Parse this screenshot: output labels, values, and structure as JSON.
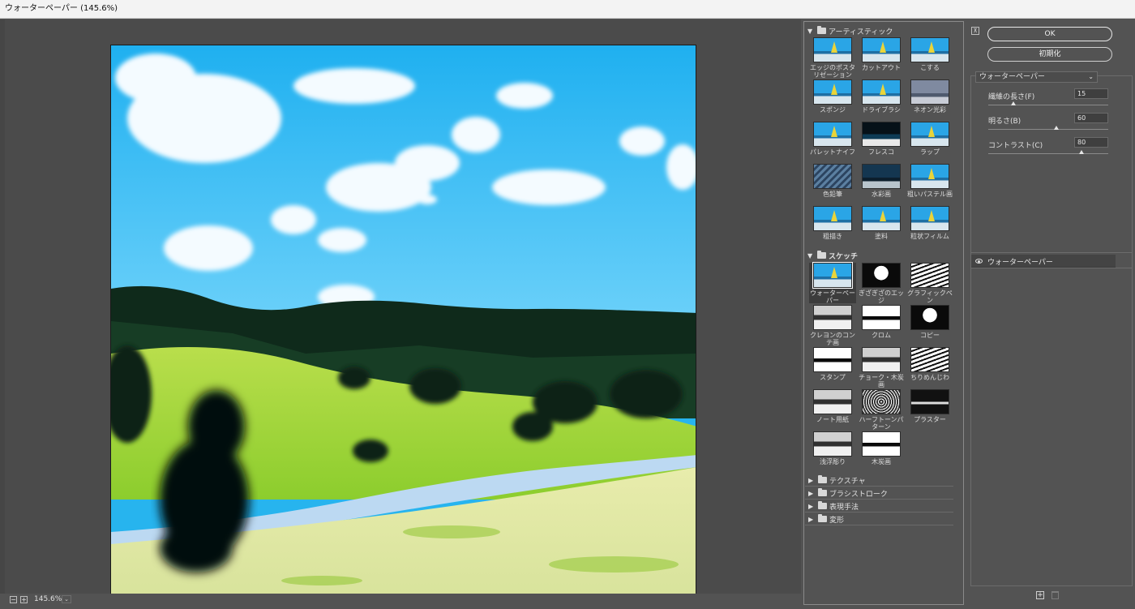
{
  "window": {
    "title": "ウォーターペーパー (145.6%)"
  },
  "statusbar": {
    "minus": "−",
    "plus": "+",
    "zoom": "145.6%",
    "zoom_caret": "⌄"
  },
  "gallery": {
    "categories": [
      {
        "label": "アーティスティック",
        "expanded": true,
        "items": [
          {
            "label": "エッジのポスタリゼーション",
            "style": "color"
          },
          {
            "label": "カットアウト",
            "style": "color"
          },
          {
            "label": "こする",
            "style": "color"
          },
          {
            "label": "スポンジ",
            "style": "color"
          },
          {
            "label": "ドライブラシ",
            "style": "color"
          },
          {
            "label": "ネオン光彩",
            "style": "grey"
          },
          {
            "label": "パレットナイフ",
            "style": "color"
          },
          {
            "label": "フレスコ",
            "style": "fresco"
          },
          {
            "label": "ラップ",
            "style": "color"
          },
          {
            "label": "色鉛筆",
            "style": "pencil"
          },
          {
            "label": "水彩画",
            "style": "dark"
          },
          {
            "label": "粗いパステル画",
            "style": "color"
          },
          {
            "label": "粗描き",
            "style": "color"
          },
          {
            "label": "塗料",
            "style": "color"
          },
          {
            "label": "粒状フィルム",
            "style": "color"
          }
        ]
      },
      {
        "label": "スケッチ",
        "expanded": true,
        "items": [
          {
            "label": "ウォーターペーパー",
            "style": "color",
            "selected": true
          },
          {
            "label": "ぎざぎざのエッジ",
            "style": "blackwhite"
          },
          {
            "label": "グラフィックペン",
            "style": "bw2"
          },
          {
            "label": "クレヨンのコンテ画",
            "style": "mid"
          },
          {
            "label": "クロム",
            "style": "bw"
          },
          {
            "label": "コピー",
            "style": "blackwhite"
          },
          {
            "label": "スタンプ",
            "style": "bw"
          },
          {
            "label": "チョーク・木炭画",
            "style": "mid"
          },
          {
            "label": "ちりめんじわ",
            "style": "bw2"
          },
          {
            "label": "ノート用紙",
            "style": "mid"
          },
          {
            "label": "ハーフトーンパターン",
            "style": "halftone"
          },
          {
            "label": "プラスター",
            "style": "plaster"
          },
          {
            "label": "浅浮彫り",
            "style": "mid"
          },
          {
            "label": "木炭画",
            "style": "bw"
          }
        ]
      }
    ],
    "collapsed": [
      "テクスチャ",
      "ブラシストローク",
      "表現手法",
      "変形"
    ]
  },
  "panel": {
    "collapse_icon": "⊼",
    "ok_label": "OK",
    "reset_label": "初期化",
    "filter_name": "ウォーターペーパー",
    "filter_caret": "⌄",
    "params": [
      {
        "label": "繊維の長さ(F)",
        "value": "15",
        "fraction": 0.21
      },
      {
        "label": "明るさ(B)",
        "value": "60",
        "fraction": 0.57
      },
      {
        "label": "コントラスト(C)",
        "value": "80",
        "fraction": 0.78
      }
    ],
    "layer_name": "ウォーターペーパー",
    "add_icon": "+"
  }
}
